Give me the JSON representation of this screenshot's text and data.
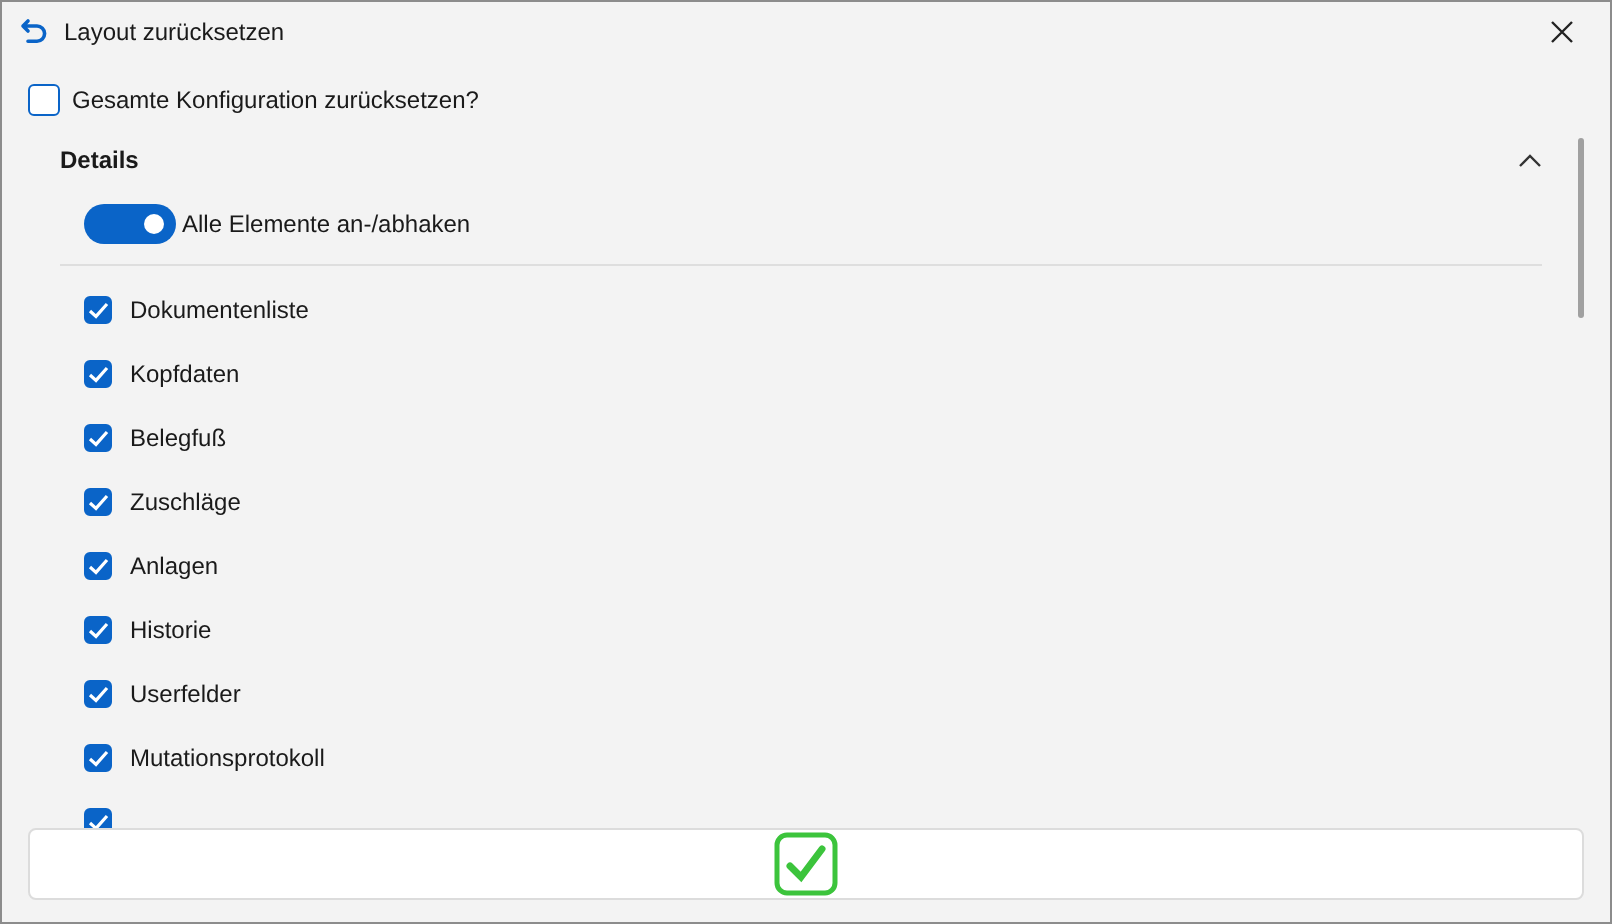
{
  "window": {
    "title": "Layout zurücksetzen"
  },
  "reset_all": {
    "label": "Gesamte Konfiguration zurücksetzen?",
    "checked": false
  },
  "section": {
    "title": "Details",
    "expanded": true
  },
  "toggle_all": {
    "label": "Alle Elemente an-/abhaken",
    "on": true
  },
  "items": [
    {
      "label": "Dokumentenliste",
      "checked": true
    },
    {
      "label": "Kopfdaten",
      "checked": true
    },
    {
      "label": "Belegfuß",
      "checked": true
    },
    {
      "label": "Zuschläge",
      "checked": true
    },
    {
      "label": "Anlagen",
      "checked": true
    },
    {
      "label": "Historie",
      "checked": true
    },
    {
      "label": "Userfelder",
      "checked": true
    },
    {
      "label": "Mutationsprotokoll",
      "checked": true
    },
    {
      "checked": true
    }
  ]
}
